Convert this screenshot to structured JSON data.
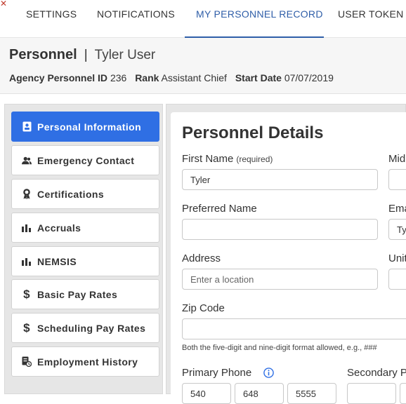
{
  "top_tabs": [
    {
      "label": "SETTINGS"
    },
    {
      "label": "NOTIFICATIONS"
    },
    {
      "label": "MY PERSONNEL RECORD"
    },
    {
      "label": "USER TOKEN"
    }
  ],
  "header": {
    "title": "Personnel",
    "separator": "|",
    "user_name": "Tyler User",
    "agency_id_label": "Agency Personnel ID",
    "agency_id_value": "236",
    "rank_label": "Rank",
    "rank_value": "Assistant Chief",
    "start_date_label": "Start Date",
    "start_date_value": "07/07/2019"
  },
  "sidebar": {
    "items": [
      {
        "label": "Personal Information",
        "icon": "id-card-icon"
      },
      {
        "label": "Emergency Contact",
        "icon": "users-icon"
      },
      {
        "label": "Certifications",
        "icon": "award-icon"
      },
      {
        "label": "Accruals",
        "icon": "bar-chart-icon"
      },
      {
        "label": "NEMSIS",
        "icon": "bar-chart-icon"
      },
      {
        "label": "Basic Pay Rates",
        "icon": "dollar-icon"
      },
      {
        "label": "Scheduling Pay Rates",
        "icon": "dollar-icon"
      },
      {
        "label": "Employment History",
        "icon": "history-icon"
      }
    ]
  },
  "details": {
    "title": "Personnel Details",
    "first_name_label": "First Name",
    "first_name_required": "(required)",
    "first_name_value": "Tyler",
    "middle_label": "Mid",
    "preferred_name_label": "Preferred Name",
    "preferred_name_value": "",
    "email_label": "Ema",
    "email_value": "Ty",
    "address_label": "Address",
    "address_placeholder": "Enter a location",
    "unit_label": "Unit",
    "zip_label": "Zip Code",
    "zip_value": "",
    "zip_hint": "Both the five-digit and nine-digit format allowed, e.g., ###",
    "primary_phone_label": "Primary Phone",
    "secondary_phone_label": "Secondary P",
    "phone_part1": "540",
    "phone_part2": "648",
    "phone_part3": "5555"
  },
  "colors": {
    "accent": "#2f5ea8",
    "active_nav": "#2f6fe4"
  }
}
